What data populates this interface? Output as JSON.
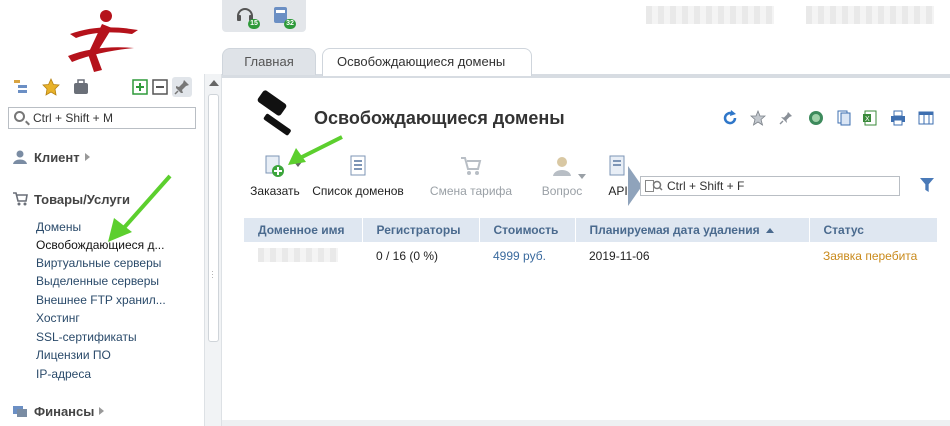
{
  "header": {
    "notifications": [
      {
        "icon": "headset-icon",
        "count": "15"
      },
      {
        "icon": "billing-icon",
        "count": "32"
      }
    ]
  },
  "tabs": [
    {
      "label": "Главная",
      "active": false
    },
    {
      "label": "Освобождающиеся домены",
      "active": true
    }
  ],
  "sidebar": {
    "search_placeholder": "Ctrl + Shift + M",
    "sections": [
      {
        "label": "Клиент",
        "icon": "user-icon"
      },
      {
        "label": "Товары/Услуги",
        "icon": "cart-icon"
      },
      {
        "label": "Финансы",
        "icon": "finance-icon"
      }
    ],
    "items": [
      "Домены",
      "Освобождающиеся д...",
      "Виртуальные серверы",
      "Выделенные серверы",
      "Внешнее FTP хранил...",
      "Хостинг",
      "SSL-сертификаты",
      "Лицензии ПО",
      "IP-адреса"
    ],
    "active_item_index": 1
  },
  "main": {
    "title": "Освобождающиеся домены",
    "toolbar": {
      "order": "Заказать",
      "domain_list": "Список доменов",
      "change_tariff": "Смена тарифа",
      "question": "Вопрос",
      "api": "API"
    },
    "filter_placeholder": "Ctrl + Shift + F",
    "table": {
      "columns": [
        "Доменное имя",
        "Регистраторы",
        "Стоимость",
        "Планируемая дата удаления",
        "Статус"
      ],
      "rows": [
        {
          "domain": "",
          "registrars": "0 / 16 (0 %)",
          "price": "4999 руб.",
          "delete_date": "2019-11-06",
          "status": "Заявка перебита"
        }
      ]
    }
  },
  "colors": {
    "accent_green": "#5ccf2e",
    "header_blue": "#4a6a8e",
    "status_orange": "#c98a1b",
    "logo_red": "#b5121b"
  }
}
